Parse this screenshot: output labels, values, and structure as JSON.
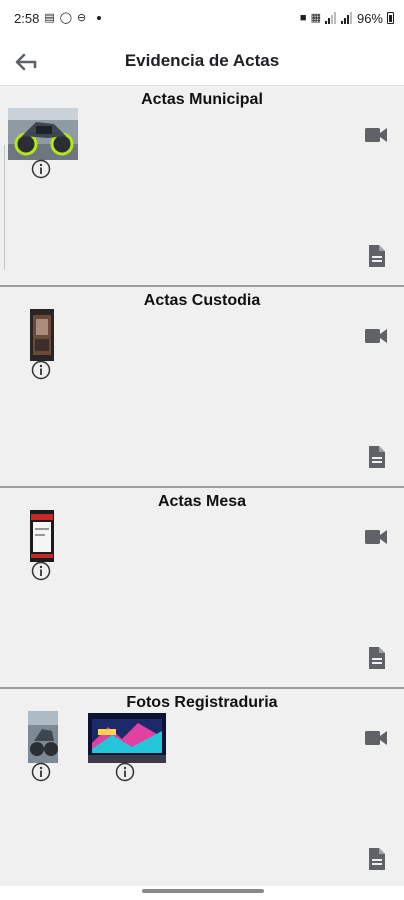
{
  "status_bar": {
    "time": "2:58",
    "battery": "96%"
  },
  "app_bar": {
    "title": "Evidencia de Actas"
  },
  "sections": [
    {
      "title": "Actas Municipal"
    },
    {
      "title": "Actas Custodia"
    },
    {
      "title": "Actas Mesa"
    },
    {
      "title": "Fotos Registraduria"
    }
  ],
  "icons": {
    "back": "arrow-back-icon",
    "video": "videocam-icon",
    "document": "description-icon",
    "info": "info-outline-icon"
  },
  "colors": {
    "icon": "#5f6368",
    "background": "#f0f0f0",
    "divider": "#9e9e9e"
  }
}
